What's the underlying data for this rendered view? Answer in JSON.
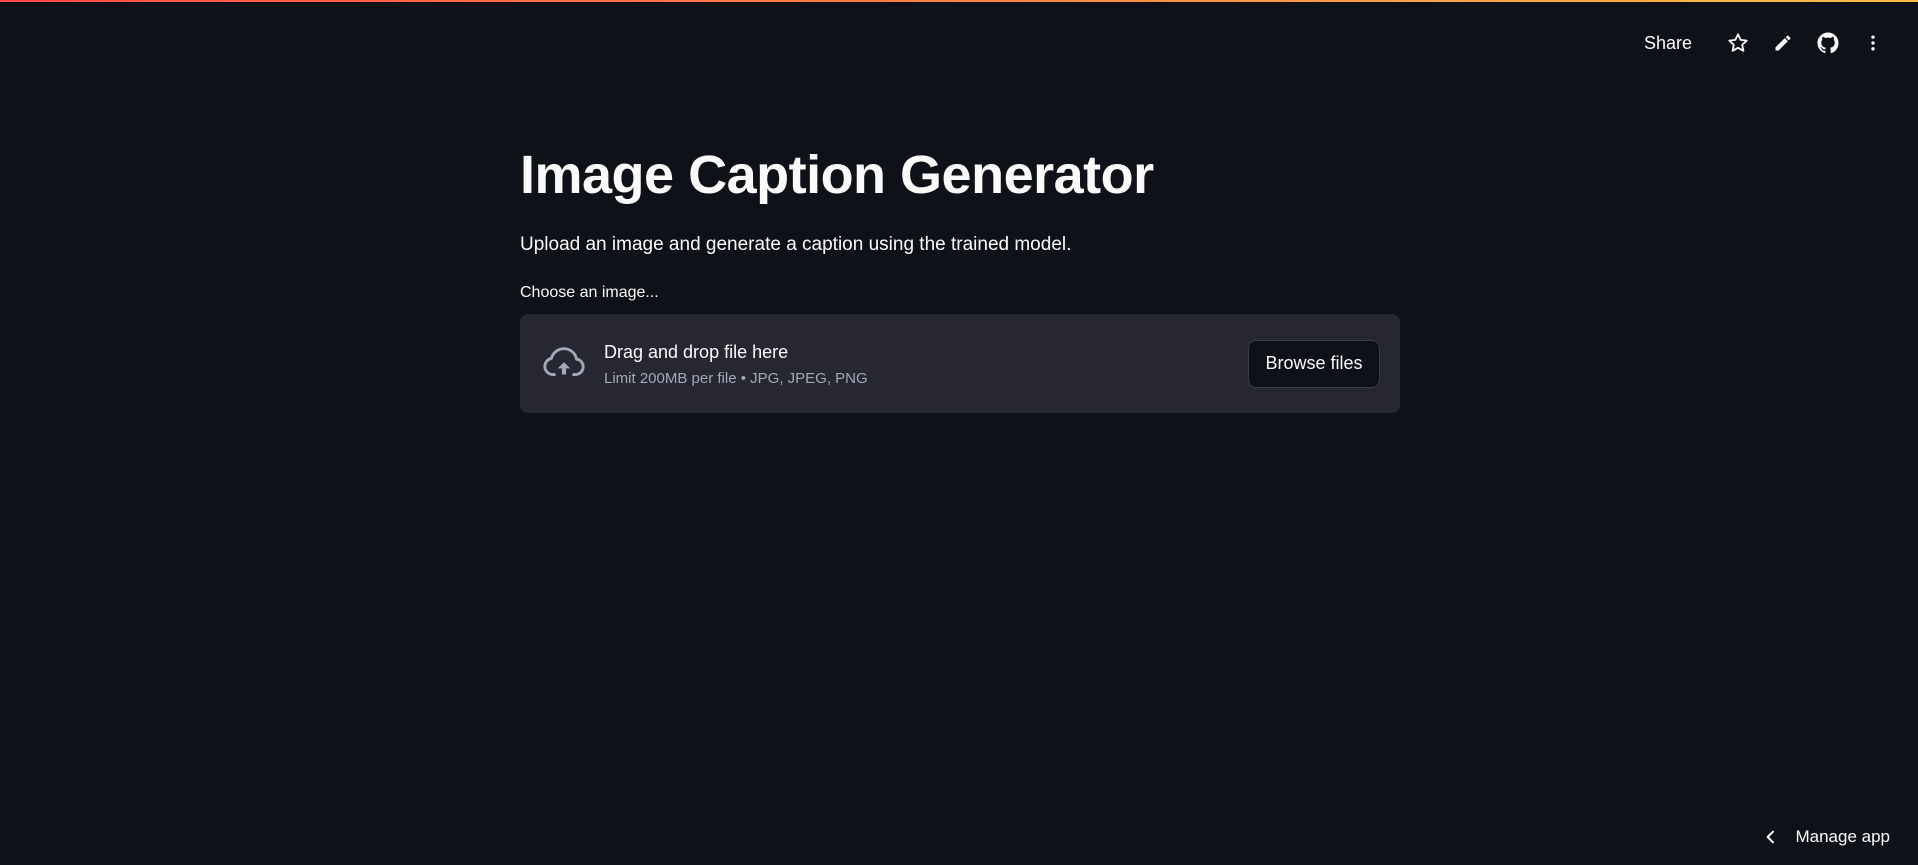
{
  "toolbar": {
    "share_label": "Share",
    "icons": [
      "star-icon",
      "pencil-icon",
      "github-icon",
      "more-vertical-icon"
    ]
  },
  "main": {
    "title": "Image Caption Generator",
    "subtitle": "Upload an image and generate a caption using the trained model.",
    "uploader": {
      "label": "Choose an image...",
      "drop_text": "Drag and drop file here",
      "limit_text": "Limit 200MB per file • JPG, JPEG, PNG",
      "browse_label": "Browse files",
      "icon": "cloud-upload-icon"
    }
  },
  "footer": {
    "manage_app_label": "Manage app",
    "icon": "chevron-left-icon"
  },
  "colors": {
    "background": "#0e1117",
    "panel": "#262730",
    "text": "#fafafa",
    "muted_text": "#a3a8b8",
    "accent_start": "#ff4b4b",
    "accent_end": "#ffbd45"
  }
}
